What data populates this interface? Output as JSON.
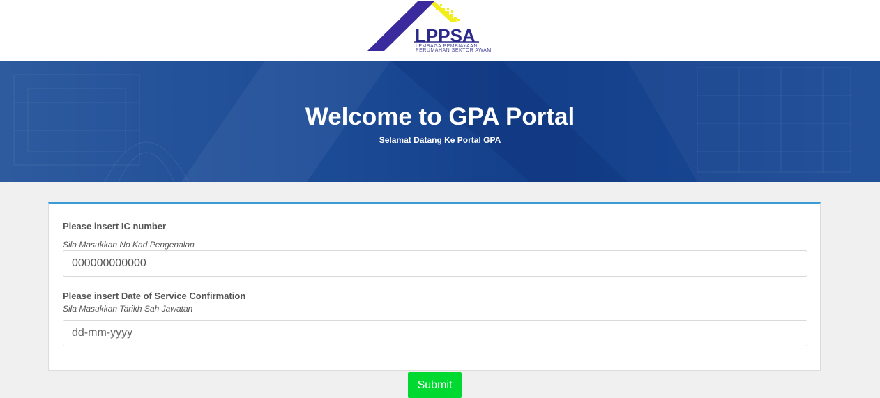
{
  "logo": {
    "name": "LPPSA",
    "subtitle_line1": "LEMBAGA PEMBIAYAAN",
    "subtitle_line2": "PERUMAHAN SEKTOR AWAM"
  },
  "hero": {
    "title": "Welcome to GPA Portal",
    "subtitle": "Selamat Datang Ke Portal GPA"
  },
  "form": {
    "ic": {
      "label_en": "Please insert IC number",
      "label_ms": "Sila Masukkan No Kad Pengenalan",
      "value": "000000000000",
      "placeholder": ""
    },
    "service_date": {
      "label_en": "Please insert Date of Service Confirmation",
      "label_ms": "Sila Masukkan Tarikh Sah Jawatan",
      "value": "",
      "placeholder": "dd-mm-yyyy"
    },
    "submit_label": "Submit"
  },
  "colors": {
    "hero_blue": "#1d4c97",
    "card_top_border": "#3a9bd5",
    "submit_green": "#00d92f",
    "logo_purple": "#3b2a9e",
    "logo_yellow": "#f2ee1a"
  }
}
